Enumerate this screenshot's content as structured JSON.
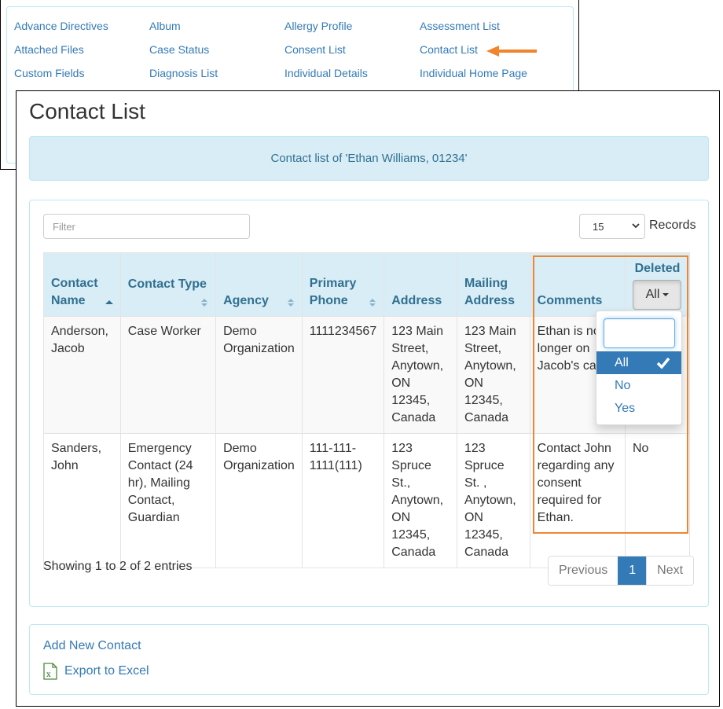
{
  "menu": {
    "items": [
      {
        "label": "Advance Directives"
      },
      {
        "label": "Album"
      },
      {
        "label": "Allergy Profile"
      },
      {
        "label": "Assessment List"
      },
      {
        "label": "Attached Files"
      },
      {
        "label": "Case Status"
      },
      {
        "label": "Consent List"
      },
      {
        "label": "Contact List"
      },
      {
        "label": "Custom Fields"
      },
      {
        "label": "Diagnosis List"
      },
      {
        "label": "Individual Details"
      },
      {
        "label": "Individual Home Page"
      }
    ],
    "highlighted_item": "Contact List",
    "arrow_color": "#f0852d"
  },
  "page": {
    "title": "Contact List",
    "subtitle": "Contact list of 'Ethan Williams, 01234'"
  },
  "controls": {
    "filter_placeholder": "Filter",
    "filter_value": "",
    "records_per_page": "15",
    "records_label": "Records"
  },
  "table": {
    "columns": [
      {
        "label": "Contact Name",
        "sort": "asc"
      },
      {
        "label": "Contact Type",
        "sort": "both"
      },
      {
        "label": "Agency",
        "sort": "both"
      },
      {
        "label": "Primary Phone",
        "sort": "both"
      },
      {
        "label": "Address",
        "sort": "none"
      },
      {
        "label": "Mailing Address",
        "sort": "none"
      },
      {
        "label": "Comments",
        "sort": "none"
      },
      {
        "label": "Deleted",
        "sort": "none"
      }
    ],
    "deleted_filter": {
      "selected": "All",
      "options": [
        "All",
        "No",
        "Yes"
      ],
      "search_value": ""
    },
    "rows": [
      {
        "contact_name": "Anderson, Jacob",
        "contact_type": "Case Worker",
        "agency": "Demo Organization",
        "primary_phone": "1111234567",
        "address": "123 Main Street, Anytown, ON 12345, Canada",
        "mailing_address": "123 Main Street, Anytown, ON 12345, Canada",
        "comments": "Ethan is no longer on Jacob's ca",
        "deleted": ""
      },
      {
        "contact_name": "Sanders, John",
        "contact_type": "Emergency Contact (24 hr), Mailing Contact, Guardian",
        "agency": "Demo Organization",
        "primary_phone": "111-111-1111(111)",
        "address": "123 Spruce St., Anytown, ON 12345, Canada",
        "mailing_address": "123 Spruce St. , Anytown, ON 12345, Canada",
        "comments": "Contact John regarding any consent required for Ethan.",
        "deleted": "No"
      }
    ],
    "highlight_color": "#f0852d"
  },
  "footer": {
    "info": "Showing 1 to 2 of 2 entries",
    "pagination": {
      "previous": "Previous",
      "current_page": "1",
      "next": "Next"
    }
  },
  "actions": {
    "add_new": "Add New Contact",
    "export": "Export to Excel"
  },
  "colors": {
    "link": "#337ab7",
    "header_bg": "#d9edf7",
    "header_text": "#31708f",
    "active": "#337ab7"
  }
}
